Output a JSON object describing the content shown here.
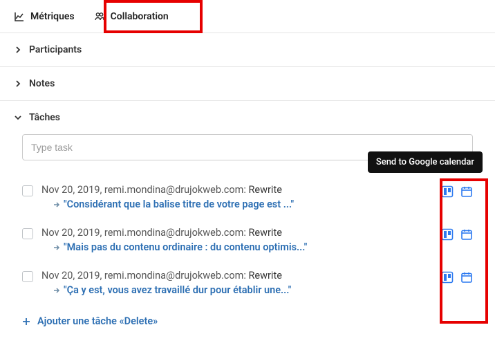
{
  "tabs": {
    "metrics": {
      "label": "Métriques"
    },
    "collaboration": {
      "label": "Collaboration"
    }
  },
  "sections": {
    "participants": {
      "label": "Participants"
    },
    "notes": {
      "label": "Notes"
    },
    "tasks": {
      "label": "Tâches"
    }
  },
  "task_input": {
    "placeholder": "Type task"
  },
  "tooltip": {
    "text": "Send to Google calendar"
  },
  "tasks": [
    {
      "meta": "Nov 20, 2019, remi.mondina@drujokweb.com: ",
      "title": "Rewrite",
      "quote": "\"Considérant que la balise titre de votre page est ...\""
    },
    {
      "meta": "Nov 20, 2019, remi.mondina@drujokweb.com: ",
      "title": "Rewrite",
      "quote": "\"Mais pas du contenu ordinaire : du contenu optimis...\""
    },
    {
      "meta": "Nov 20, 2019, remi.mondina@drujokweb.com: ",
      "title": "Rewrite",
      "quote": "\"Ça y est, vous avez travaillé dur pour établir une...\""
    }
  ],
  "add_task": {
    "label": "Ajouter une tâche «Delete»"
  }
}
